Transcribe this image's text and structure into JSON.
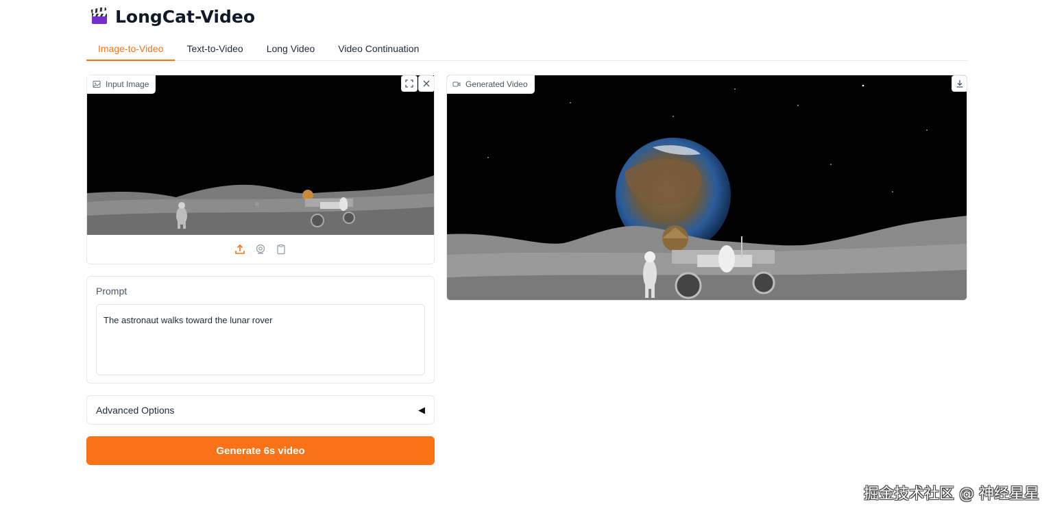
{
  "app": {
    "title": "LongCat-Video",
    "title_icon": "clapperboard-icon"
  },
  "tabs": [
    {
      "label": "Image-to-Video",
      "active": true
    },
    {
      "label": "Text-to-Video",
      "active": false
    },
    {
      "label": "Long Video",
      "active": false
    },
    {
      "label": "Video Continuation",
      "active": false
    }
  ],
  "input_image": {
    "label": "Input Image",
    "label_icon": "image-icon",
    "actions": [
      "fullscreen-icon",
      "close-icon"
    ],
    "sources": [
      "upload-icon",
      "webcam-icon",
      "clipboard-icon"
    ]
  },
  "generated_video": {
    "label": "Generated Video",
    "label_icon": "video-camera-icon",
    "actions": [
      "download-icon"
    ]
  },
  "prompt": {
    "label": "Prompt",
    "value": "The astronaut walks toward the lunar rover"
  },
  "advanced": {
    "label": "Advanced Options",
    "caret": "◀"
  },
  "generate_button": {
    "label": "Generate 6s video"
  },
  "watermark": "掘金技术社区 @ 神经星星",
  "colors": {
    "accent": "#f97316",
    "border": "#e5e7eb",
    "text": "#1f2937"
  }
}
